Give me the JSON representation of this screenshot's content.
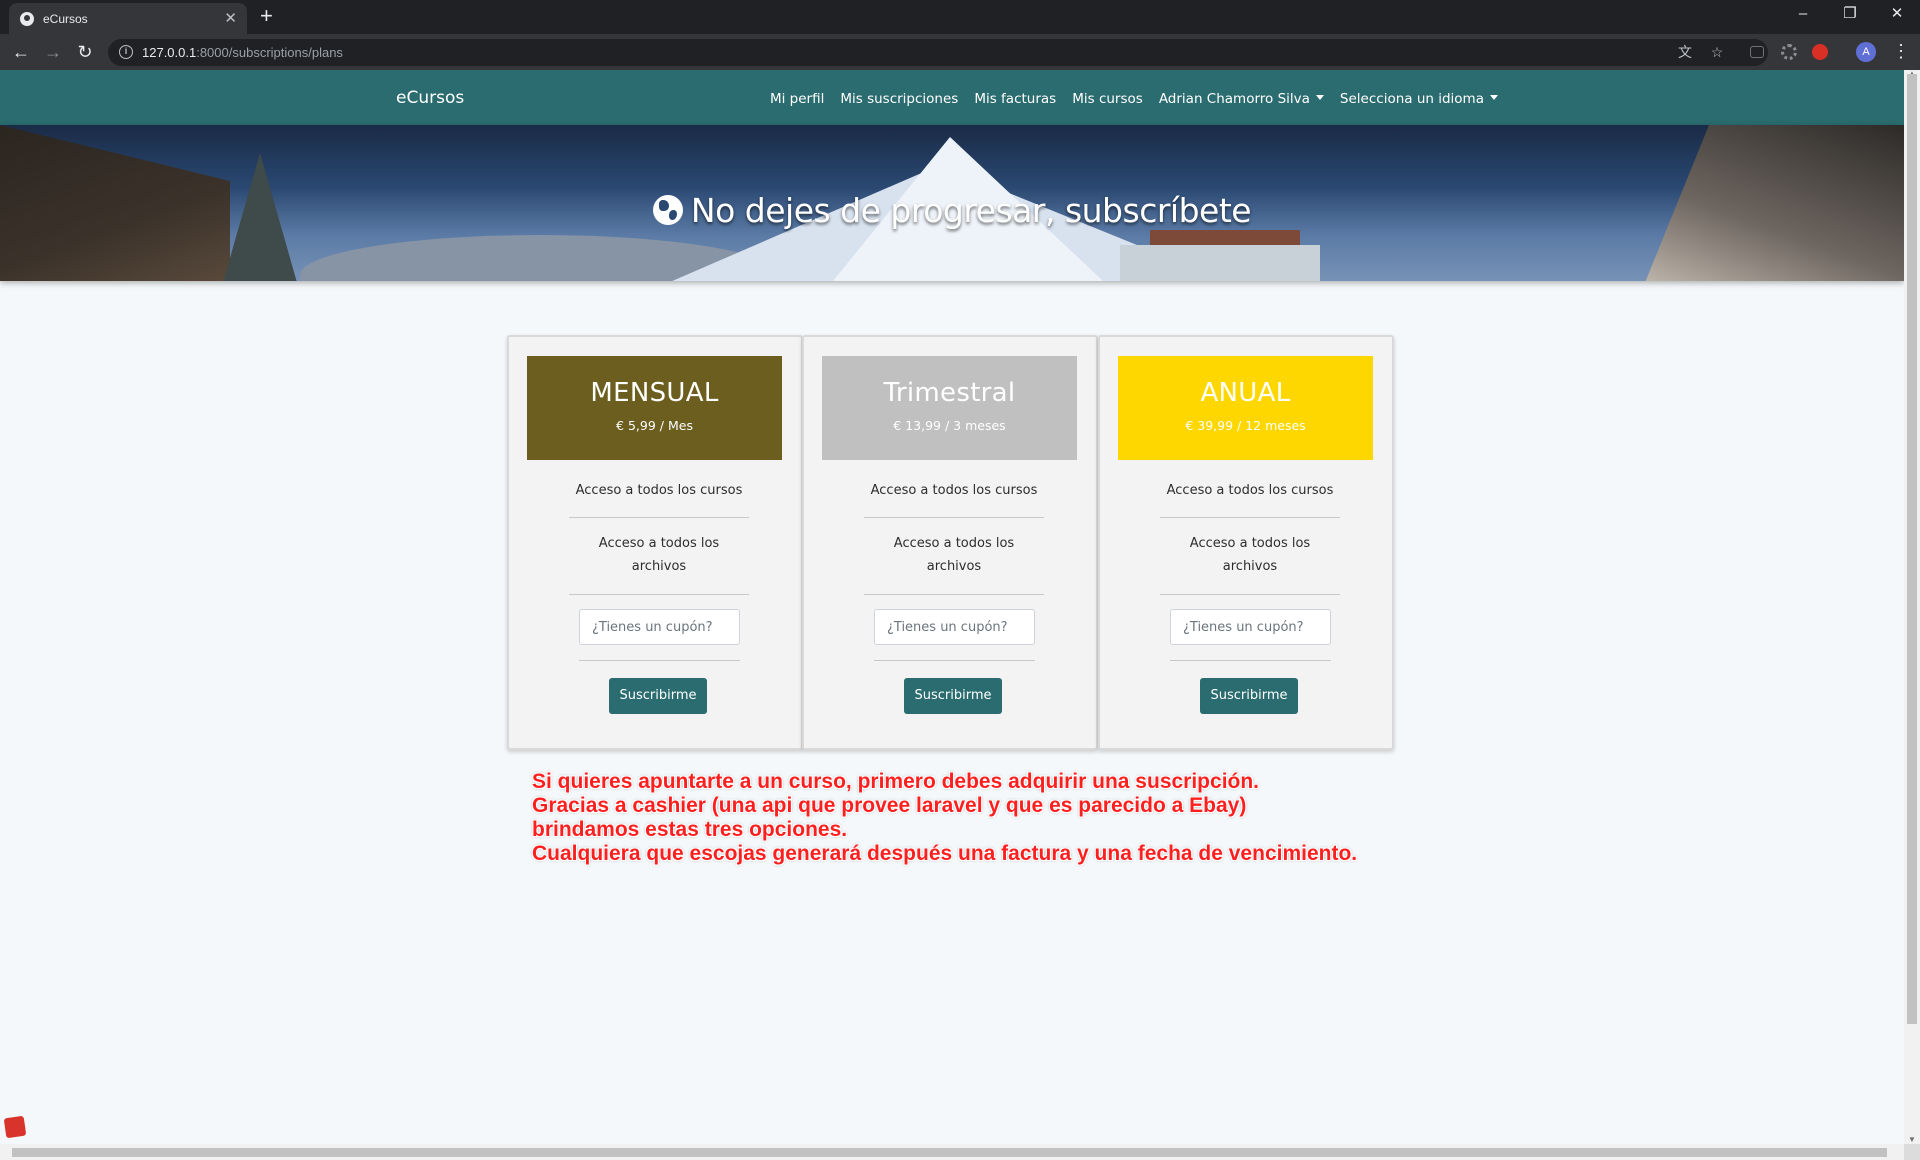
{
  "browser": {
    "tab_title": "eCursos",
    "tab_close": "✕",
    "new_tab": "+",
    "url_host": "127.0.0.1",
    "url_rest": ":8000/subscriptions/plans",
    "avatar_letter": "A"
  },
  "navbar": {
    "brand": "eCursos",
    "links": [
      "Mi perfil",
      "Mis suscripciones",
      "Mis facturas",
      "Mis cursos"
    ],
    "user_menu": "Adrian Chamorro Silva",
    "language_menu": "Selecciona un idioma"
  },
  "hero": {
    "title": "No dejes de progresar, subscríbete"
  },
  "plans": [
    {
      "name": "MENSUAL",
      "price": "€ 5,99 / Mes",
      "color": "#6b5e1f",
      "features": [
        "Acceso a todos los cursos",
        "Acceso a todos los archivos"
      ],
      "coupon_placeholder": "¿Tienes un cupón?",
      "button": "Suscribirme"
    },
    {
      "name": "Trimestral",
      "price": "€ 13,99 / 3 meses",
      "color": "#c0c0c0",
      "features": [
        "Acceso a todos los cursos",
        "Acceso a todos los archivos"
      ],
      "coupon_placeholder": "¿Tienes un cupón?",
      "button": "Suscribirme"
    },
    {
      "name": "ANUAL",
      "price": "€ 39,99 / 12 meses",
      "color": "#ffd700",
      "features": [
        "Acceso a todos los cursos",
        "Acceso a todos los archivos"
      ],
      "coupon_placeholder": "¿Tienes un cupón?",
      "button": "Suscribirme"
    }
  ],
  "annotation": [
    "Si quieres apuntarte a un curso, primero debes adquirir una suscripción.",
    "Gracias a cashier (una api que provee laravel y que es parecido a Ebay)",
    "brindamos estas tres opciones.",
    "Cualquiera que escojas generará después una factura y una fecha de vencimiento."
  ]
}
